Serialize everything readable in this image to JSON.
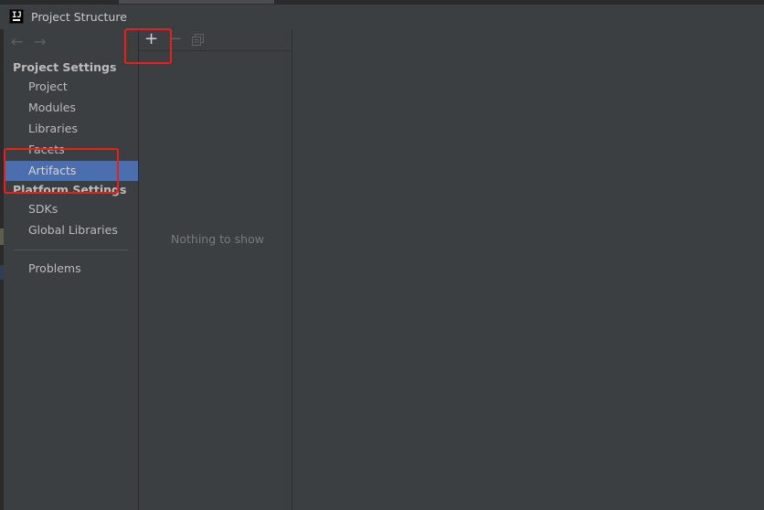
{
  "window": {
    "title": "Project Structure",
    "app_icon": "intellij-idea-icon"
  },
  "navigation": {
    "back": "←",
    "forward": "→"
  },
  "sidebar": {
    "project_settings_heading": "Project Settings",
    "project_items": [
      {
        "label": "Project"
      },
      {
        "label": "Modules"
      },
      {
        "label": "Libraries"
      },
      {
        "label": "Facets"
      },
      {
        "label": "Artifacts",
        "selected": true
      }
    ],
    "platform_settings_heading": "Platform Settings",
    "platform_items": [
      {
        "label": "SDKs"
      },
      {
        "label": "Global Libraries"
      }
    ],
    "problems_label": "Problems"
  },
  "toolbar": {
    "add": "+",
    "remove": "−"
  },
  "middle_pane": {
    "empty_text": "Nothing to show"
  },
  "colors": {
    "background": "#3c3f41",
    "selection": "#4b6eaf",
    "highlight_box": "#ee1c1c"
  }
}
